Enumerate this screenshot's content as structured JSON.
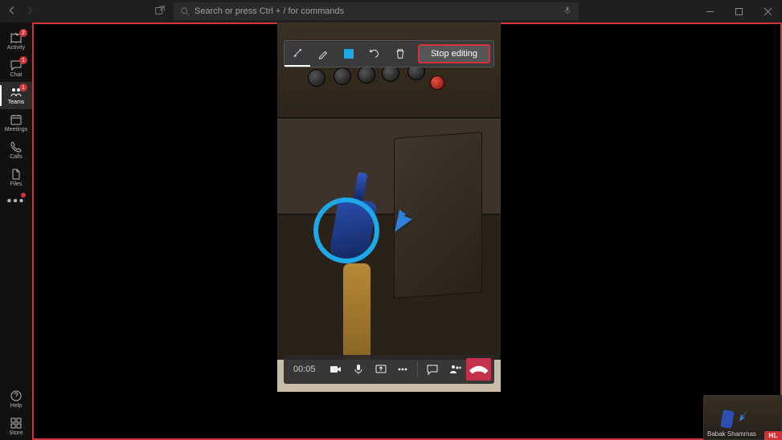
{
  "titlebar": {
    "search_placeholder": "Search or press Ctrl + / for commands"
  },
  "rail": {
    "items": [
      {
        "id": "activity",
        "label": "Activity",
        "badge": "2"
      },
      {
        "id": "chat",
        "label": "Chat",
        "badge": "1"
      },
      {
        "id": "teams",
        "label": "Teams",
        "badge": "1"
      },
      {
        "id": "meetings",
        "label": "Meetings",
        "badge": ""
      },
      {
        "id": "calls",
        "label": "Calls",
        "badge": ""
      },
      {
        "id": "files",
        "label": "Files",
        "badge": ""
      }
    ],
    "more_label": "…",
    "help_label": "Help",
    "store_label": "Store"
  },
  "edit_toolbar": {
    "stop_label": "Stop editing",
    "tools": [
      "arrow-pointer",
      "pen",
      "color",
      "undo",
      "delete"
    ]
  },
  "callbar": {
    "timer": "00:05"
  },
  "pip": {
    "participant_name": "Babak Shammas",
    "presence_label": "HL"
  },
  "annotation": {
    "circle_color": "#1fa8e8",
    "arrow_color": "#2f7fdc"
  }
}
